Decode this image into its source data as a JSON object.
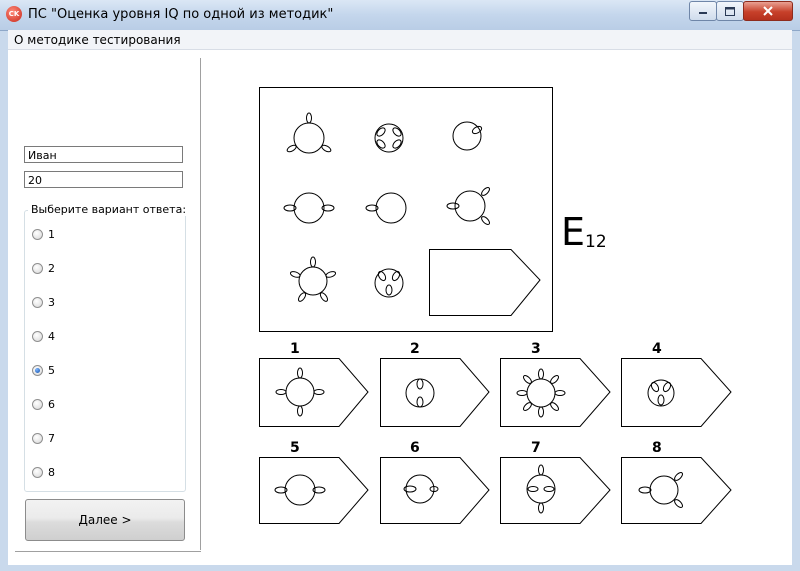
{
  "window": {
    "title": "ПС \"Оценка уровня IQ по одной из методик\"",
    "icon_text": "CK"
  },
  "menu": {
    "items": [
      "О методике тестирования"
    ]
  },
  "form": {
    "name_value": "Иван",
    "age_value": "20",
    "group_label": "Выберите вариант ответа:",
    "options": [
      "1",
      "2",
      "3",
      "4",
      "5",
      "6",
      "7",
      "8"
    ],
    "selected": "5",
    "next_label": "Далее >"
  },
  "puzzle": {
    "code_letter": "E",
    "code_number": "12",
    "answer_numbers": [
      "1",
      "2",
      "3",
      "4",
      "5",
      "6",
      "7",
      "8"
    ]
  },
  "icons": {
    "minimize": "minimize-icon",
    "maximize": "maximize-icon",
    "close": "close-icon"
  }
}
